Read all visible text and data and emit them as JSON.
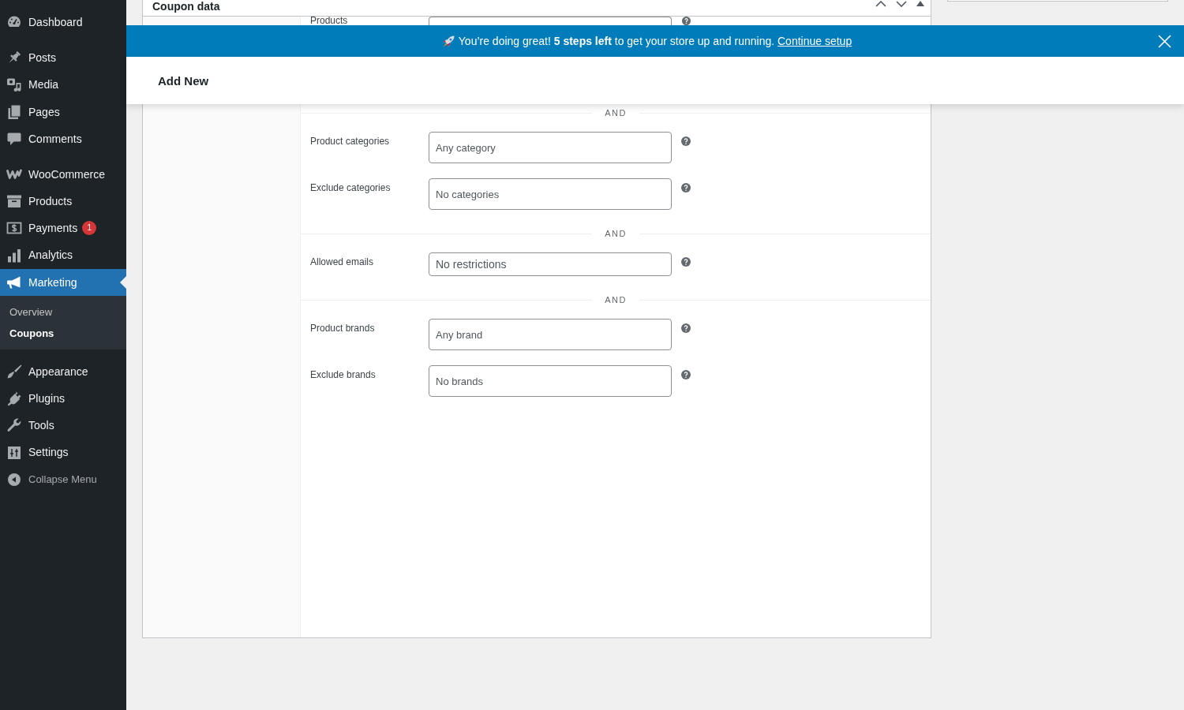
{
  "sidebar": {
    "groups": [
      [
        {
          "label": "Dashboard",
          "selected": false
        }
      ],
      [
        {
          "label": "Posts",
          "selected": false
        },
        {
          "label": "Media",
          "selected": false
        },
        {
          "label": "Pages",
          "selected": false
        },
        {
          "label": "Comments",
          "selected": false
        }
      ],
      [
        {
          "label": "WooCommerce",
          "selected": false
        },
        {
          "label": "Products",
          "selected": false
        },
        {
          "label": "Payments",
          "selected": false,
          "badge": "1"
        },
        {
          "label": "Analytics",
          "selected": false
        },
        {
          "label": "Marketing",
          "selected": true,
          "children": [
            {
              "label": "Overview",
              "selected": false
            },
            {
              "label": "Coupons",
              "selected": true
            }
          ]
        }
      ],
      [
        {
          "label": "Appearance",
          "selected": false
        },
        {
          "label": "Plugins",
          "selected": false
        },
        {
          "label": "Tools",
          "selected": false
        },
        {
          "label": "Settings",
          "selected": false
        }
      ]
    ],
    "collapse_menu": {
      "label": "Collapse Menu"
    }
  },
  "coupon_panel": {
    "title": "Coupon data",
    "top_rows": [
      {
        "label": "Products",
        "kind": "select"
      }
    ],
    "sections": [
      {
        "separator": "AND",
        "fields": [
          {
            "label": "Product categories",
            "placeholder": "Any category",
            "kind": "select"
          },
          {
            "label": "Exclude categories",
            "placeholder": "No categories",
            "kind": "select"
          }
        ]
      },
      {
        "separator": "AND",
        "fields": [
          {
            "label": "Allowed emails",
            "placeholder": "No restrictions",
            "kind": "text"
          }
        ]
      },
      {
        "separator": "AND",
        "fields": [
          {
            "label": "Product brands",
            "placeholder": "Any brand",
            "kind": "select"
          },
          {
            "label": "Exclude brands",
            "placeholder": "No brands",
            "kind": "select"
          }
        ]
      }
    ]
  },
  "notice": {
    "message": "You’re doing great! **5 steps left** to get your store up and running.",
    "link": "Continue setup"
  },
  "page_header": {
    "title": "Add New"
  }
}
